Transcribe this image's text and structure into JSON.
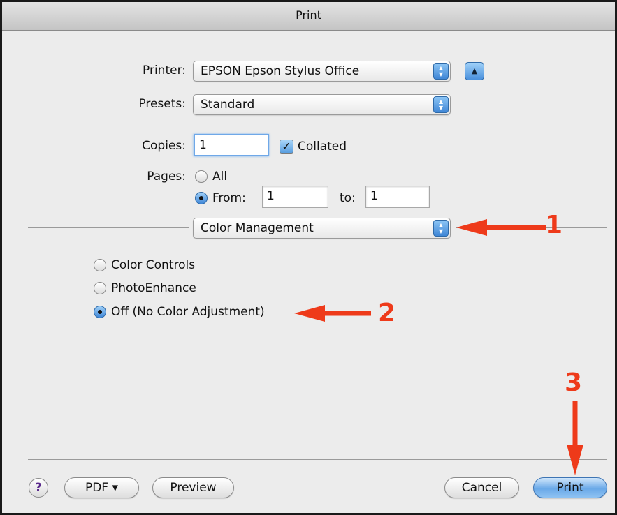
{
  "window": {
    "title": "Print"
  },
  "printer": {
    "label": "Printer:",
    "value": "EPSON Epson Stylus Office"
  },
  "presets": {
    "label": "Presets:",
    "value": "Standard"
  },
  "copies": {
    "label": "Copies:",
    "value": "1",
    "collated_label": "Collated",
    "collated_checked": true
  },
  "pages": {
    "label": "Pages:",
    "all_label": "All",
    "from_label": "From:",
    "from_value": "1",
    "to_label": "to:",
    "to_value": "1",
    "selected": "from"
  },
  "panel_menu": {
    "value": "Color Management"
  },
  "color_options": [
    {
      "label": "Color Controls",
      "selected": false
    },
    {
      "label": "PhotoEnhance",
      "selected": false
    },
    {
      "label": "Off (No Color Adjustment)",
      "selected": true
    }
  ],
  "buttons": {
    "help": "?",
    "pdf": "PDF ▾",
    "preview": "Preview",
    "cancel": "Cancel",
    "print": "Print"
  },
  "annotations": {
    "one": "1",
    "two": "2",
    "three": "3",
    "color": "#ee3a1a"
  }
}
